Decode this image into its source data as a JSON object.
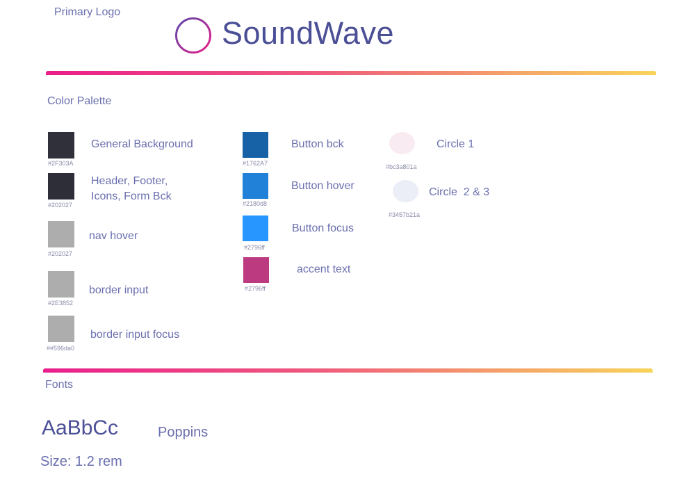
{
  "logo": {
    "section_label": "Primary Logo",
    "brand_name": "SoundWave",
    "icon": "sound-wave-icon",
    "gradient": [
      "#6a3fae",
      "#e91e8c"
    ]
  },
  "palette": {
    "section_label": "Color Palette",
    "col1": [
      {
        "label": "General Background",
        "code": "#2F303A",
        "color": "#2F303A"
      },
      {
        "label": "Header, Footer,\nIcons, Form Bck",
        "code": "#202027",
        "color": "#2d2e38"
      },
      {
        "label": "nav hover",
        "code": "#202027",
        "color": "#adadad"
      },
      {
        "label": "border input",
        "code": "#2E3852",
        "color": "#adadad"
      },
      {
        "label": "border input focus",
        "code": "##596da0",
        "color": "#adadad"
      }
    ],
    "col2": [
      {
        "label": "Button bck",
        "code": "#1762A7",
        "color": "#1762A7"
      },
      {
        "label": "Button hover",
        "code": "#2180d8",
        "color": "#2180d8"
      },
      {
        "label": "Button focus",
        "code": "#2796ff",
        "color": "#2796ff"
      },
      {
        "label": "accent text",
        "code": "#2796ff",
        "color": "#bc3a80"
      }
    ],
    "col3": [
      {
        "label": "Circle 1",
        "code": "#bc3a801a",
        "color": "#f8ecf2"
      },
      {
        "label": "Circle  2 & 3",
        "code": "#3457b21a",
        "color": "#ebeef6"
      }
    ]
  },
  "fonts": {
    "section_label": "Fonts",
    "sample": "AaBbCc",
    "name": "Poppins",
    "size": "Size: 1.2 rem"
  }
}
